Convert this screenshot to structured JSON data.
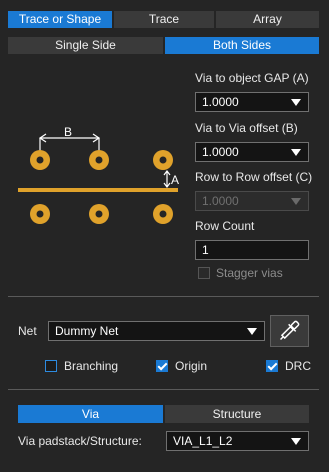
{
  "top_tabs": [
    "Trace or Shape",
    "Trace",
    "Array"
  ],
  "side_tabs": [
    "Single Side",
    "Both Sides"
  ],
  "diagram": {
    "label_b": "B",
    "label_a": "A",
    "pad_color": "#e0a22b"
  },
  "via_gap": {
    "label": "Via to object GAP (A)",
    "value": "1.0000"
  },
  "via_offset": {
    "label": "Via to Via offset (B)",
    "value": "1.0000"
  },
  "row_offset": {
    "label": "Row to Row offset (C)",
    "value": "1.0000"
  },
  "row_count": {
    "label": "Row Count",
    "value": "1"
  },
  "stagger": {
    "label": "Stagger vias",
    "checked": false
  },
  "net": {
    "label": "Net",
    "value": "Dummy Net"
  },
  "options": {
    "branching": {
      "label": "Branching",
      "checked": false
    },
    "origin": {
      "label": "Origin",
      "checked": true
    },
    "drc": {
      "label": "DRC",
      "checked": true
    }
  },
  "bottom_tabs": [
    "Via",
    "Structure"
  ],
  "padstack": {
    "label": "Via padstack/Structure:",
    "value": "VIA_L1_L2"
  },
  "colors": {
    "accent": "#1a7ad4",
    "pad": "#e0a22b",
    "background": "#252525"
  },
  "icons": [
    "eyedropper-icon",
    "chevron-down-icon",
    "checkmark-icon"
  ]
}
